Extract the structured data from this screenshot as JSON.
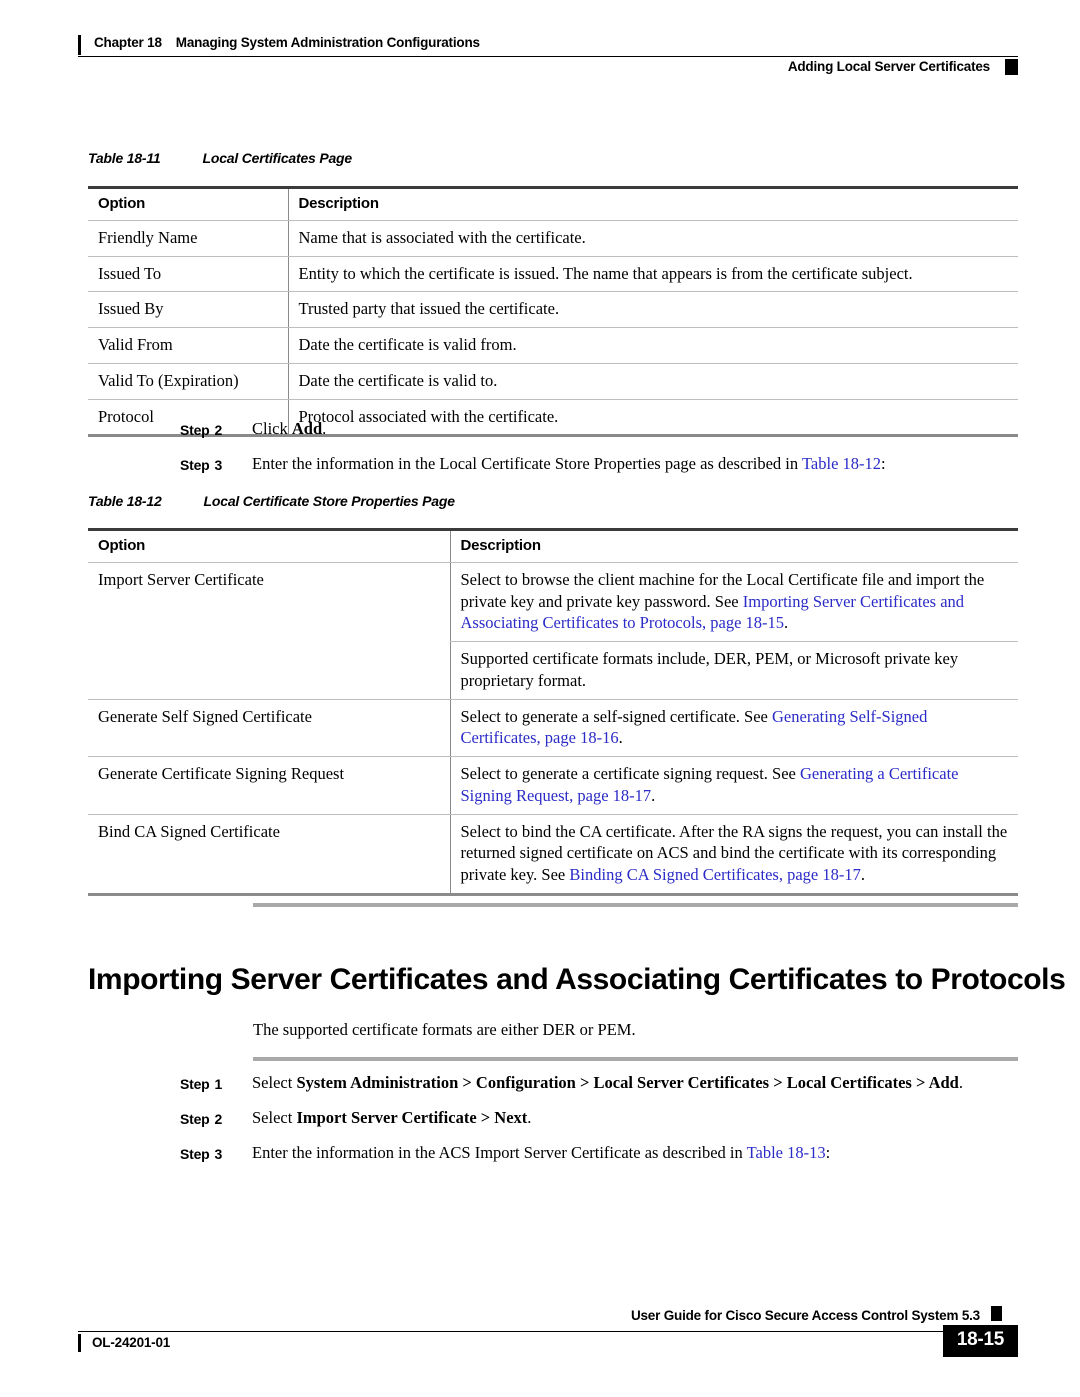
{
  "header": {
    "chapter_number": "Chapter 18",
    "chapter_title": "Managing System Administration Configurations",
    "running_head_right": "Adding Local Server Certificates"
  },
  "colors": {
    "link_blue": "#2b2bc8",
    "rule_gray": "#a9a9a9",
    "table_rule_light": "#bdbdbd",
    "table_rule_dark": "#3b3b3b"
  },
  "table_18_11": {
    "caption_label": "Table 18-11",
    "caption_title": "Local Certificates Page",
    "columns": [
      "Option",
      "Description"
    ],
    "rows": [
      [
        "Friendly Name",
        "Name that is associated with the certificate."
      ],
      [
        "Issued To",
        "Entity to which the certificate is issued. The name that appears is from the certificate subject."
      ],
      [
        "Issued By",
        "Trusted party that issued the certificate."
      ],
      [
        "Valid From",
        "Date the certificate is valid from."
      ],
      [
        "Valid To (Expiration)",
        "Date the certificate is valid to."
      ],
      [
        "Protocol",
        "Protocol associated with the certificate."
      ]
    ]
  },
  "steps_mid": [
    {
      "label": "Step",
      "number": "2",
      "text_before": "Click ",
      "bold": "Add",
      "text_after": "."
    },
    {
      "label": "Step",
      "number": "3",
      "text_before": "Enter the information in the Local Certificate Store Properties page as described in ",
      "link": "Table 18-12",
      "text_after": ":"
    }
  ],
  "table_18_12": {
    "caption_label": "Table 18-12",
    "caption_title": "Local Certificate Store Properties Page",
    "columns": [
      "Option",
      "Description"
    ],
    "rows": [
      {
        "option": "Import Server Certificate",
        "desc_plain": "Select to browse the client machine for the Local Certificate file and import the private key and private key password. See ",
        "desc_link": "Importing Server Certificates and Associating Certificates to Protocols, page 18-15",
        "desc_tail": "."
      },
      {
        "option": "",
        "desc_plain": "Supported certificate formats include, DER, PEM, or Microsoft private key proprietary format.",
        "desc_link": "",
        "desc_tail": ""
      },
      {
        "option": "Generate Self Signed Certificate",
        "desc_plain": "Select to generate a self-signed certificate. See ",
        "desc_link": "Generating Self-Signed Certificates, page 18-16",
        "desc_tail": "."
      },
      {
        "option": "Generate Certificate Signing Request",
        "desc_plain": "Select to generate a certificate signing request. See ",
        "desc_link": "Generating a Certificate Signing Request, page 18-17",
        "desc_tail": "."
      },
      {
        "option": "Bind CA Signed Certificate",
        "desc_plain": "Select to bind the CA certificate. After the RA signs the request, you can install the returned signed certificate on ACS and bind the certificate with its corresponding private key. See ",
        "desc_link": "Binding CA Signed Certificates, page 18-17",
        "desc_tail": "."
      }
    ]
  },
  "section": {
    "heading": "Importing Server Certificates and Associating Certificates to Protocols",
    "intro": "The supported certificate formats are either DER or PEM."
  },
  "steps_bottom": [
    {
      "label": "Step",
      "number": "1",
      "text_before": "Select ",
      "bold": "System Administration > Configuration > Local Server Certificates > Local Certificates > Add",
      "text_after": "."
    },
    {
      "label": "Step",
      "number": "2",
      "text_before": "Select ",
      "bold": "Import Server Certificate > Next",
      "text_after": "."
    },
    {
      "label": "Step",
      "number": "3",
      "text_before": "Enter the information in the ACS Import Server Certificate as described in ",
      "link": "Table 18-13",
      "text_after": ":"
    }
  ],
  "footer": {
    "doc_id": "OL-24201-01",
    "guide_title": "User Guide for Cisco Secure Access Control System 5.3",
    "page_number": "18-15"
  }
}
